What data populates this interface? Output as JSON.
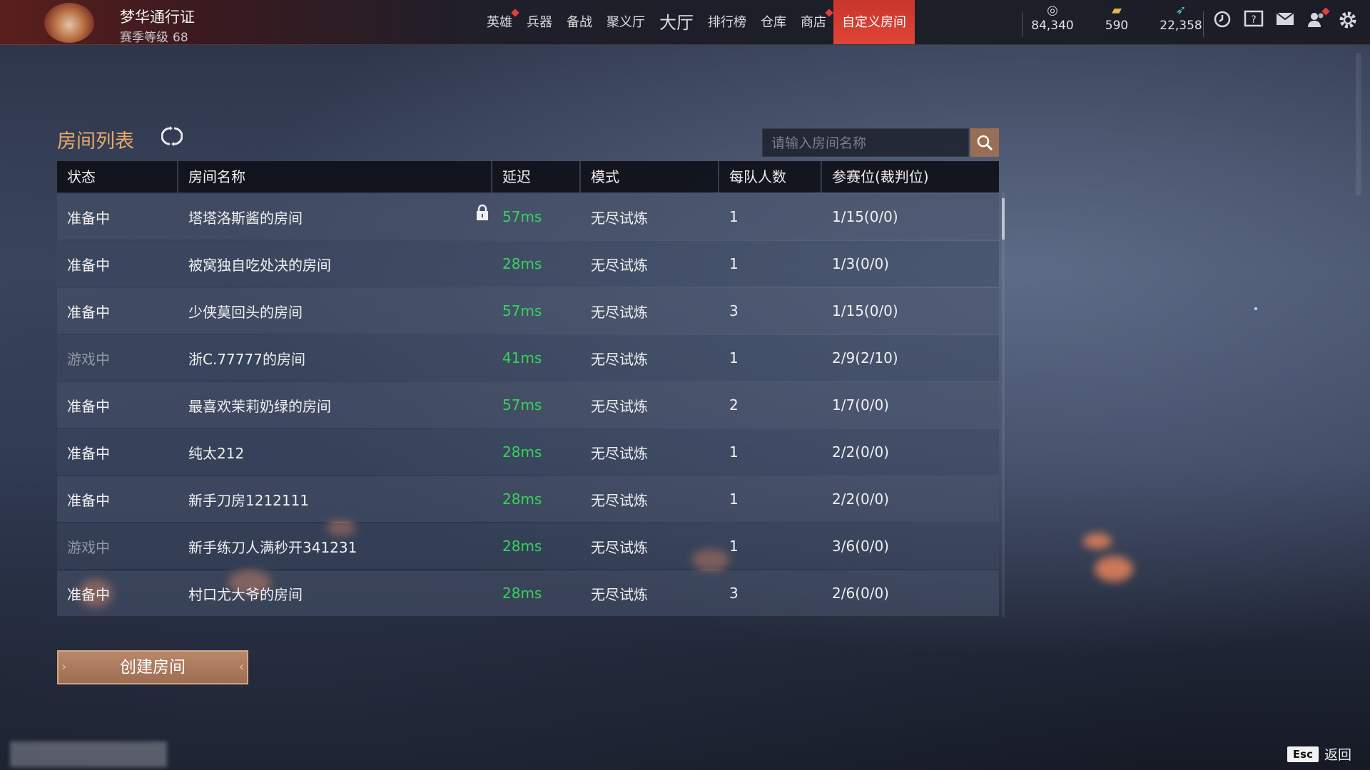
{
  "topbar": {
    "pass_title": "梦华通行证",
    "season_level_label": "赛季等级",
    "season_level": "68",
    "nav": [
      {
        "label": "英雄",
        "badge": true,
        "active": false,
        "big": false
      },
      {
        "label": "兵器",
        "badge": false,
        "active": false,
        "big": false
      },
      {
        "label": "备战",
        "badge": false,
        "active": false,
        "big": false
      },
      {
        "label": "聚义厅",
        "badge": false,
        "active": false,
        "big": false
      },
      {
        "label": "大厅",
        "badge": false,
        "active": false,
        "big": true
      },
      {
        "label": "排行榜",
        "badge": false,
        "active": false,
        "big": false
      },
      {
        "label": "仓库",
        "badge": false,
        "active": false,
        "big": false
      },
      {
        "label": "商店",
        "badge": true,
        "active": false,
        "big": false
      },
      {
        "label": "自定义房间",
        "badge": false,
        "active": true,
        "big": false
      }
    ],
    "currencies": [
      {
        "icon": "coin-icon",
        "value": "84,340"
      },
      {
        "icon": "gold-ticket-icon",
        "value": "590"
      },
      {
        "icon": "feather-icon",
        "value": "22,358"
      }
    ],
    "tools": [
      "timer-icon",
      "help-book-icon",
      "mail-icon",
      "friends-icon",
      "settings-gear-icon"
    ]
  },
  "room_list": {
    "title": "房间列表",
    "search_placeholder": "请输入房间名称",
    "columns": [
      "状态",
      "房间名称",
      "延迟",
      "模式",
      "每队人数",
      "参赛位(裁判位)"
    ],
    "rows": [
      {
        "status": "准备中",
        "playing": false,
        "name": "塔塔洛斯酱的房间",
        "locked": true,
        "latency": "57ms",
        "mode": "无尽试炼",
        "per_team": "1",
        "slots": "1/15(0/0)"
      },
      {
        "status": "准备中",
        "playing": false,
        "name": "被窝独自吃处决的房间",
        "locked": false,
        "latency": "28ms",
        "mode": "无尽试炼",
        "per_team": "1",
        "slots": "1/3(0/0)"
      },
      {
        "status": "准备中",
        "playing": false,
        "name": "少侠莫回头的房间",
        "locked": false,
        "latency": "57ms",
        "mode": "无尽试炼",
        "per_team": "3",
        "slots": "1/15(0/0)"
      },
      {
        "status": "游戏中",
        "playing": true,
        "name": "浙C.77777的房间",
        "locked": false,
        "latency": "41ms",
        "mode": "无尽试炼",
        "per_team": "1",
        "slots": "2/9(2/10)"
      },
      {
        "status": "准备中",
        "playing": false,
        "name": "最喜欢茉莉奶绿的房间",
        "locked": false,
        "latency": "57ms",
        "mode": "无尽试炼",
        "per_team": "2",
        "slots": "1/7(0/0)"
      },
      {
        "status": "准备中",
        "playing": false,
        "name": "纯太212",
        "locked": false,
        "latency": "28ms",
        "mode": "无尽试炼",
        "per_team": "1",
        "slots": "2/2(0/0)"
      },
      {
        "status": "准备中",
        "playing": false,
        "name": "新手刀房1212111",
        "locked": false,
        "latency": "28ms",
        "mode": "无尽试炼",
        "per_team": "1",
        "slots": "2/2(0/0)"
      },
      {
        "status": "游戏中",
        "playing": true,
        "name": "新手练刀人满秒开341231",
        "locked": false,
        "latency": "28ms",
        "mode": "无尽试炼",
        "per_team": "1",
        "slots": "3/6(0/0)"
      },
      {
        "status": "准备中",
        "playing": false,
        "name": "村口尤大爷的房间",
        "locked": false,
        "latency": "28ms",
        "mode": "无尽试炼",
        "per_team": "3",
        "slots": "2/6(0/0)"
      }
    ],
    "create_button": "创建房间"
  },
  "footer": {
    "esc_key": "Esc",
    "back_label": "返回"
  },
  "colors": {
    "accent_orange": "#e9a96a",
    "active_tab_red": "#d83d31",
    "latency_green": "#36d35a",
    "create_button": "#a87458"
  }
}
